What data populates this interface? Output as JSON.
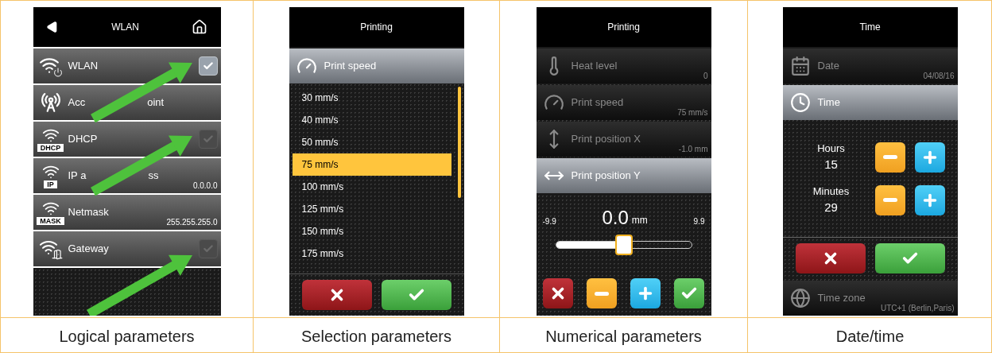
{
  "panels": [
    {
      "kind": "toggles",
      "title": "WLAN",
      "rows": [
        {
          "kind": "wlan",
          "label": "WLAN",
          "checked": true
        },
        {
          "kind": "antenna",
          "label_parts": [
            "Acc",
            "oint"
          ]
        },
        {
          "kind": "wifi",
          "badge": "DHCP",
          "label": "DHCP",
          "checked": false
        },
        {
          "kind": "wifi",
          "badge": "IP",
          "label_parts": [
            "IP a",
            "ss"
          ],
          "value": "0.0.0.0"
        },
        {
          "kind": "wifi",
          "badge": "MASK",
          "label": "Netmask",
          "value": "255.255.255.0"
        },
        {
          "kind": "door",
          "label": "Gateway",
          "checked": false
        }
      ],
      "caption": "Logical parameters"
    },
    {
      "kind": "selection",
      "title": "Printing",
      "current": {
        "kind": "speed",
        "label": "Print speed",
        "selected": true
      },
      "options": [
        {
          "label": "30 mm/s",
          "selected": false
        },
        {
          "label": "40 mm/s",
          "selected": false
        },
        {
          "label": "50 mm/s",
          "selected": false
        },
        {
          "label": "75 mm/s",
          "selected": true
        },
        {
          "label": "100 mm/s",
          "selected": false
        },
        {
          "label": "125 mm/s",
          "selected": false
        },
        {
          "label": "150 mm/s",
          "selected": false
        },
        {
          "label": "175 mm/s",
          "selected": false
        }
      ],
      "buttons": [
        {
          "kind": "cancel"
        },
        {
          "kind": "ok"
        }
      ],
      "caption": "Selection parameters"
    },
    {
      "kind": "numeric",
      "title": "Printing",
      "rows": [
        {
          "kind": "heat",
          "label": "Heat level",
          "value": "0",
          "selected": false
        },
        {
          "kind": "speed",
          "label": "Print speed",
          "value": "75 mm/s",
          "selected": false
        },
        {
          "kind": "posx",
          "label": "Print position X",
          "value": "-1.0 mm",
          "selected": false
        },
        {
          "kind": "posy",
          "label": "Print position Y",
          "selected": true
        }
      ],
      "slider": {
        "min": "-9.9",
        "value": "0.0",
        "unit": "mm",
        "max": "9.9",
        "level": 0.5
      },
      "buttons": [
        {
          "kind": "cancel"
        },
        {
          "kind": "minus"
        },
        {
          "kind": "plus"
        },
        {
          "kind": "ok"
        }
      ],
      "caption": "Numerical parameters"
    },
    {
      "kind": "datetime",
      "title": "Time",
      "rows": [
        {
          "kind": "calendar",
          "label": "Date",
          "value": "04/08/16",
          "selected": false
        },
        {
          "kind": "clock",
          "label": "Time",
          "selected": true
        }
      ],
      "fields": [
        {
          "label": "Hours",
          "value": "15"
        },
        {
          "label": "Minutes",
          "value": "29"
        }
      ],
      "buttons": [
        {
          "kind": "cancel"
        },
        {
          "kind": "ok"
        }
      ],
      "footer_row": {
        "kind": "globe",
        "label": "Time zone",
        "value": "UTC+1 (Berlin,Paris)",
        "selected": false
      },
      "caption": "Date/time"
    }
  ]
}
